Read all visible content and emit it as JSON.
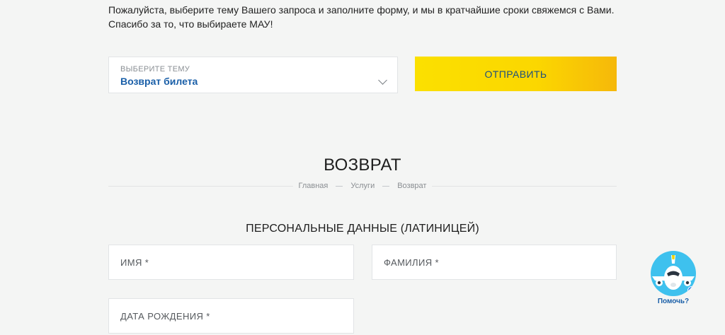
{
  "intro": {
    "line1": "Пожалуйста, выберите тему Вашего запроса и заполните форму, и мы в кратчайшие сроки свяжемся с Вами.",
    "line2": "Спасибо за то, что выбираете МАУ!"
  },
  "topic_select": {
    "caption": "Выберите тему",
    "value": "Возврат билета"
  },
  "submit_label": "Отправить",
  "section_title": "ВОЗВРАТ",
  "breadcrumb": {
    "home": "Главная",
    "services": "Услуги",
    "current": "Возврат"
  },
  "personal_data": {
    "title": "Персональные данные (латиницей)",
    "first_name_label": "Имя *",
    "last_name_label": "Фамилия *",
    "birth_date_label": "Дата рождения *"
  },
  "help_widget": {
    "label": "Помочь?"
  },
  "colors": {
    "accent_blue": "#1a5fa8",
    "button_yellow": "#fbe000",
    "help_bubble": "#3ec1ee",
    "messenger": "#1877f2"
  },
  "icons": {
    "select_arrow": "chevron-down-icon",
    "help": "airplane-mascot-icon",
    "badge": "messenger-icon"
  }
}
